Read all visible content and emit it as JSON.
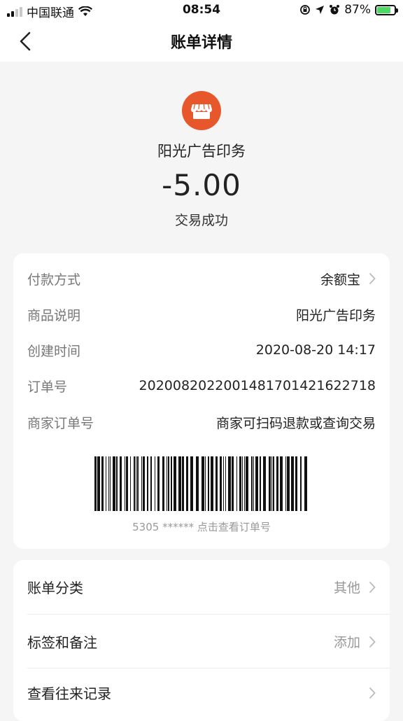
{
  "status_bar": {
    "carrier": "中国联通",
    "time": "08:54",
    "battery": "87%",
    "icons": [
      "signal-icon",
      "wifi-icon",
      "orientation-lock-icon",
      "location-icon",
      "alarm-icon",
      "battery-icon"
    ]
  },
  "nav": {
    "title": "账单详情",
    "back_icon": "back-chevron-icon"
  },
  "header": {
    "merchant_icon": "shop-icon",
    "merchant_name": "阳光广告印务",
    "amount": "-5.00",
    "status": "交易成功",
    "accent_color": "#e8572b"
  },
  "details": {
    "rows": [
      {
        "label": "付款方式",
        "value": "余额宝"
      },
      {
        "label": "商品说明",
        "value": "阳光广告印务"
      },
      {
        "label": "创建时间",
        "value": "2020-08-20 14:17"
      },
      {
        "label": "订单号",
        "value": "2020082022001481701421622718"
      },
      {
        "label": "商家订单号",
        "value": "商家可扫码退款或查询交易"
      }
    ],
    "barcode_caption": "5305 ****** 点击查看订单号"
  },
  "menu": {
    "items": [
      {
        "label": "账单分类",
        "value": "其他"
      },
      {
        "label": "标签和备注",
        "value": "添加"
      },
      {
        "label": "查看往来记录",
        "value": ""
      }
    ]
  }
}
